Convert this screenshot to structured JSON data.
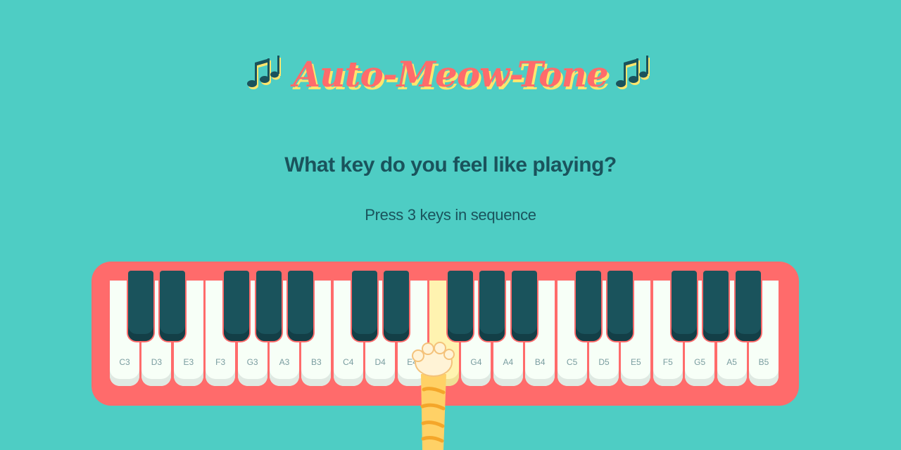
{
  "title": {
    "text": "Auto-Meow-Tone",
    "left_icon": "music-notes-icon",
    "right_icon": "music-notes-icon"
  },
  "question": "What key do you feel like playing?",
  "instruction": "Press 3 keys in sequence",
  "piano": {
    "white_keys": [
      {
        "label": "C3",
        "active": false
      },
      {
        "label": "D3",
        "active": false
      },
      {
        "label": "E3",
        "active": false
      },
      {
        "label": "F3",
        "active": false
      },
      {
        "label": "G3",
        "active": false
      },
      {
        "label": "A3",
        "active": false
      },
      {
        "label": "B3",
        "active": false
      },
      {
        "label": "C4",
        "active": false
      },
      {
        "label": "D4",
        "active": false
      },
      {
        "label": "E4",
        "active": false
      },
      {
        "label": "F4",
        "active": true
      },
      {
        "label": "G4",
        "active": false
      },
      {
        "label": "A4",
        "active": false
      },
      {
        "label": "B4",
        "active": false
      },
      {
        "label": "C5",
        "active": false
      },
      {
        "label": "D5",
        "active": false
      },
      {
        "label": "E5",
        "active": false
      },
      {
        "label": "F5",
        "active": false
      },
      {
        "label": "G5",
        "active": false
      },
      {
        "label": "A5",
        "active": false
      },
      {
        "label": "B5",
        "active": false
      }
    ],
    "black_keys_after_white_index": [
      0,
      1,
      3,
      4,
      5,
      7,
      8,
      10,
      11,
      12,
      14,
      15,
      17,
      18,
      19
    ]
  },
  "cursor_icon": "cat-paw-icon",
  "colors": {
    "background": "#4ecdc4",
    "piano_body": "#ff6b6b",
    "title": "#ff6b6b",
    "title_shadow": "#ffe66d",
    "text": "#1a535c",
    "white_key": "#f7fff7",
    "active_key": "#fff3b0",
    "black_key": "#1a535c"
  }
}
